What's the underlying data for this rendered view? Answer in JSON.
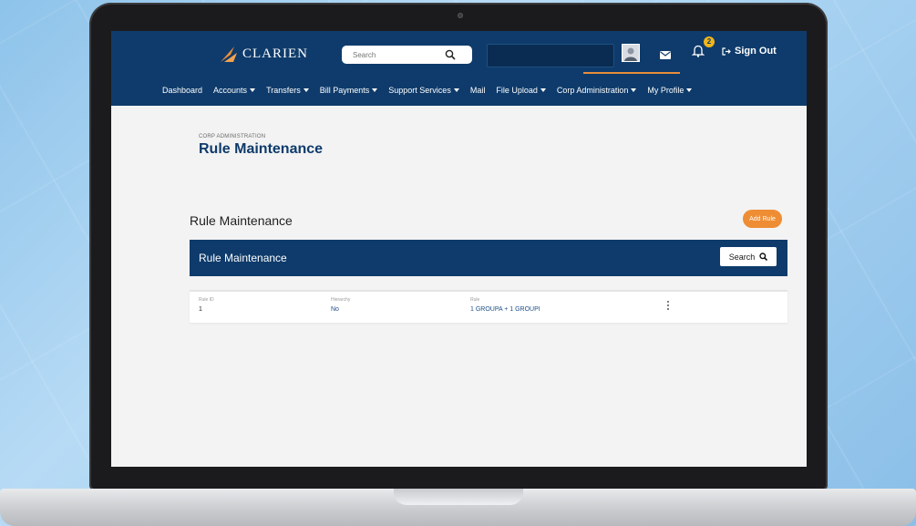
{
  "app": {
    "logo_text": "CLARIEN",
    "search_placeholder": "Search",
    "notification_count": "2",
    "sign_out_label": "Sign Out"
  },
  "nav": {
    "items": [
      {
        "label": "Dashboard",
        "dropdown": false
      },
      {
        "label": "Accounts",
        "dropdown": true
      },
      {
        "label": "Transfers",
        "dropdown": true
      },
      {
        "label": "Bill Payments",
        "dropdown": true
      },
      {
        "label": "Support Services",
        "dropdown": true
      },
      {
        "label": "Mail",
        "dropdown": false
      },
      {
        "label": "File Upload",
        "dropdown": true
      },
      {
        "label": "Corp Administration",
        "dropdown": true
      },
      {
        "label": "My Profile",
        "dropdown": true
      }
    ]
  },
  "page": {
    "breadcrumb": "CORP ADMINISTRATION",
    "title": "Rule Maintenance",
    "section_title": "Rule Maintenance",
    "add_rule_label": "Add Rule",
    "panel_title": "Rule Maintenance",
    "search_button_label": "Search"
  },
  "table": {
    "columns": [
      "Rule ID",
      "Hierarchy",
      "Rule"
    ],
    "rows": [
      {
        "rule_id": "1",
        "hierarchy": "No",
        "rule": "1 GROUPA + 1 GROUPI"
      }
    ]
  },
  "colors": {
    "header": "#0e3b6b",
    "accent": "#ee8d34",
    "badge": "#f0b51a"
  }
}
